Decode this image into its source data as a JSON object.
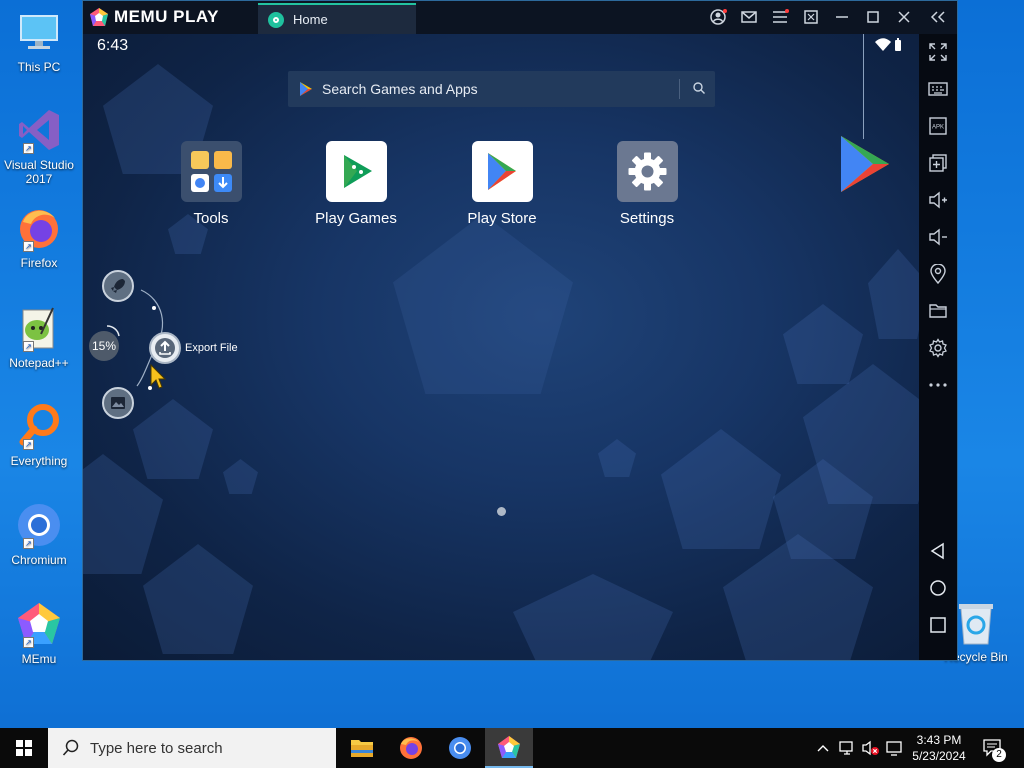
{
  "desktop": {
    "icons": [
      {
        "label": "This PC",
        "icon": "computer-icon"
      },
      {
        "label": "Visual Studio 2017",
        "icon": "visual-studio-icon"
      },
      {
        "label": "Firefox",
        "icon": "firefox-icon"
      },
      {
        "label": "Notepad++",
        "icon": "notepad-plus-plus-icon"
      },
      {
        "label": "Everything",
        "icon": "everything-search-icon"
      },
      {
        "label": "Chromium",
        "icon": "chromium-icon"
      },
      {
        "label": "MEmu",
        "icon": "memu-icon"
      }
    ],
    "recycle_bin": "Recycle Bin"
  },
  "memu": {
    "brand": "MEMU PLAY",
    "tab_label": "Home",
    "android": {
      "time": "6:43",
      "search_placeholder": "Search Games and Apps",
      "apps": [
        {
          "label": "Tools",
          "icon": "tools-folder-icon"
        },
        {
          "label": "Play Games",
          "icon": "play-games-icon"
        },
        {
          "label": "Play Store",
          "icon": "play-store-icon"
        },
        {
          "label": "Settings",
          "icon": "settings-gear-icon"
        }
      ],
      "floating_menu": {
        "progress": "15%",
        "export_label": "Export File"
      }
    },
    "sidebar_tools": [
      "fullscreen-icon",
      "keyboard-icon",
      "apk-install-icon",
      "multi-instance-icon",
      "volume-up-icon",
      "volume-down-icon",
      "location-icon",
      "folder-icon",
      "settings-icon",
      "more-icon"
    ],
    "nav_buttons": [
      "back-icon",
      "home-icon",
      "recents-icon"
    ]
  },
  "taskbar": {
    "search_placeholder": "Type here to search",
    "time": "3:43 PM",
    "date": "5/23/2024",
    "notification_count": "2"
  },
  "colors": {
    "desktop_blue": "#0b6fd6",
    "memu_accent": "#23c3a0",
    "android_bg": "#173565"
  }
}
